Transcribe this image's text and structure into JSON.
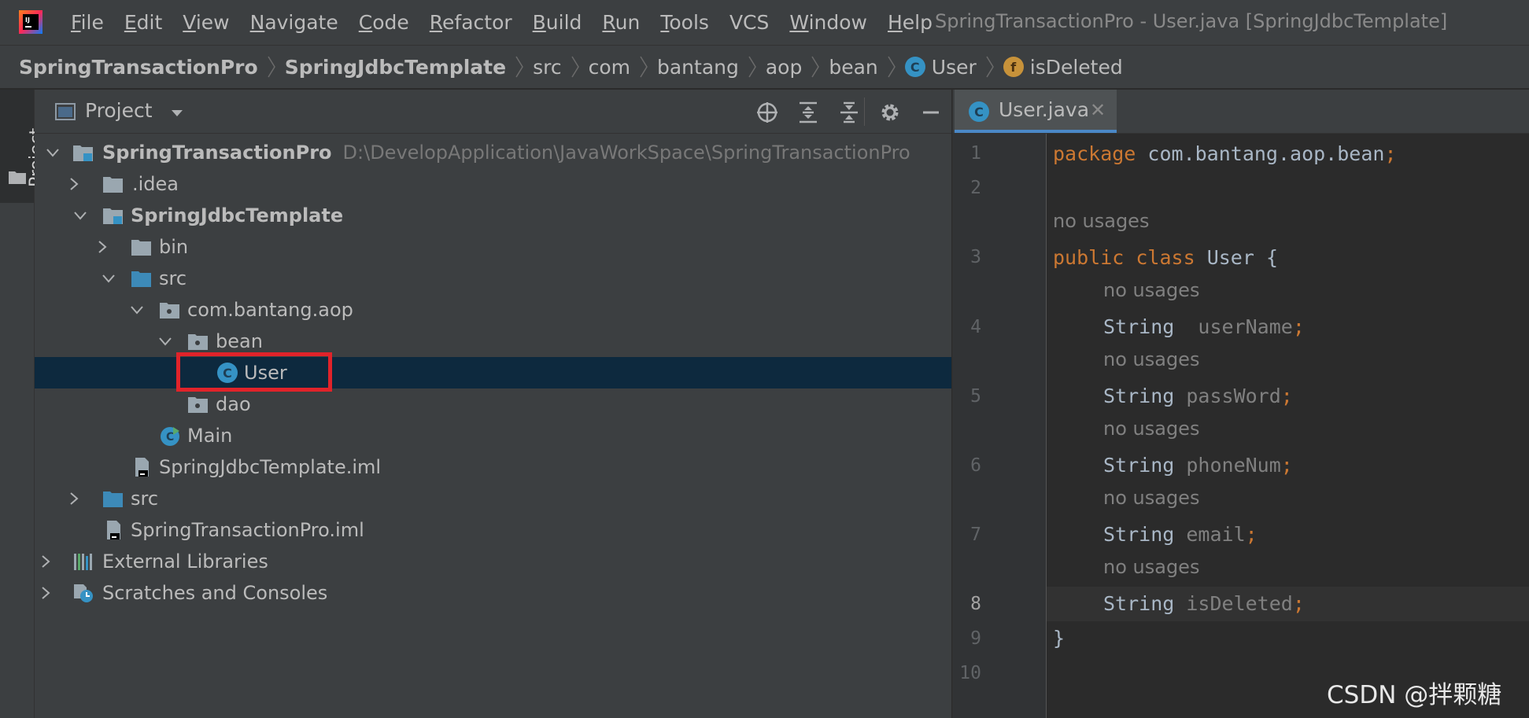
{
  "menubar": {
    "items": [
      {
        "mnemonic": "F",
        "rest": "ile"
      },
      {
        "mnemonic": "E",
        "rest": "dit"
      },
      {
        "mnemonic": "V",
        "rest": "iew"
      },
      {
        "mnemonic": "N",
        "rest": "avigate"
      },
      {
        "mnemonic": "C",
        "rest": "ode"
      },
      {
        "mnemonic": "R",
        "rest": "efactor"
      },
      {
        "mnemonic": "B",
        "rest": "uild"
      },
      {
        "mnemonic": "R",
        "rest": "un"
      },
      {
        "mnemonic": "T",
        "rest": "ools"
      },
      {
        "mnemonic": "",
        "rest": "VCS"
      },
      {
        "mnemonic": "W",
        "rest": "indow"
      },
      {
        "mnemonic": "H",
        "rest": "elp"
      }
    ],
    "window_title": "SpringTransactionPro - User.java [SpringJdbcTemplate]"
  },
  "breadcrumb": {
    "items": [
      "SpringTransactionPro",
      "SpringJdbcTemplate",
      "src",
      "com",
      "bantang",
      "aop",
      "bean",
      "User",
      "isDeleted"
    ],
    "class_icon_letter": "C",
    "field_icon_letter": "f"
  },
  "tool_strip": {
    "project_tab": "Project"
  },
  "project_panel": {
    "title": "Project",
    "tree": [
      {
        "label": "SpringTransactionPro",
        "path": "D:\\DevelopApplication\\JavaWorkSpace\\SpringTransactionPro"
      },
      {
        "label": ".idea"
      },
      {
        "label": "SpringJdbcTemplate"
      },
      {
        "label": "bin"
      },
      {
        "label": "src"
      },
      {
        "label": "com.bantang.aop"
      },
      {
        "label": "bean"
      },
      {
        "label": "User"
      },
      {
        "label": "dao"
      },
      {
        "label": "Main"
      },
      {
        "label": "SpringJdbcTemplate.iml"
      },
      {
        "label": "src"
      },
      {
        "label": "SpringTransactionPro.iml"
      },
      {
        "label": "External Libraries"
      },
      {
        "label": "Scratches and Consoles"
      }
    ]
  },
  "editor": {
    "tab": {
      "label": "User.java",
      "icon_letter": "C",
      "close": "✕"
    },
    "line_numbers": [
      "1",
      "2",
      "3",
      "4",
      "5",
      "6",
      "7",
      "8",
      "9",
      "10"
    ],
    "hint": "no usages",
    "code": {
      "l1_kw": "package",
      "l1_rest": " com.bantang.aop.bean",
      "semi": ";",
      "l3_kw1": "public",
      "l3_kw2": "class",
      "l3_name": "User",
      "l3_brace": " {",
      "type": "String",
      "f1": "userName",
      "f2": "passWord",
      "f3": "phoneNum",
      "f4": "email",
      "f5": "isDeleted",
      "close_brace": "}"
    }
  },
  "watermark": "CSDN @拌颗糖",
  "colors": {
    "keyword": "#cc7832",
    "field": "#9876aa",
    "selection": "#0d293e",
    "highlight_box": "#e0232a",
    "class_icon": "#3592c4"
  }
}
